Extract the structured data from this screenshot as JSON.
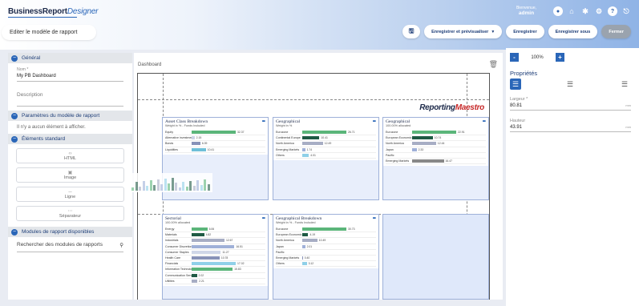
{
  "header": {
    "brand_main": "BusinessReport",
    "brand_sub": "Designer",
    "welcome": "Bienvenue,",
    "user": "admin",
    "icons": [
      "user-icon",
      "home-icon",
      "settings-icon",
      "gear-icon",
      "help-icon",
      "logout-icon"
    ]
  },
  "page_title": "Editer le modèle de rapport",
  "actions": {
    "save_icon": "save-icon",
    "save_preview": "Enregistrer et prévisualiser",
    "save": "Enregistrer",
    "save_as": "Enregistrer sous",
    "close": "Fermer"
  },
  "left": {
    "general": "Général",
    "name_label": "Nom *",
    "name_value": "My PB Dashboard",
    "desc_placeholder": "Description",
    "params_title": "Paramètres du modèle de rapport",
    "params_empty": "Il n'y a aucun élément à afficher.",
    "std_title": "Éléments standard",
    "std_items": [
      "HTML",
      "Image",
      "Ligne",
      "Séparateur"
    ],
    "modules_title": "Modules de rapport disponibles",
    "modules_search": "Rechercher des modules de rapports"
  },
  "canvas": {
    "name": "Dashboard",
    "logo_main": "Reporting",
    "logo_sub": "Maestro",
    "cards": [
      {
        "title": "Asset Class Breakdown",
        "sub": "Weight in % - Funds Included",
        "rows": [
          [
            "Equity",
            32.37,
            "#5bb57a"
          ],
          [
            "Alternative investments",
            2.15,
            "#ccd3e6"
          ],
          [
            "Bonds",
            6.39,
            "#8892b8"
          ],
          [
            "Liquidities",
            10.41,
            "#6fc0d8"
          ]
        ]
      },
      {
        "title": "Geographical",
        "sub": "Weight in %",
        "rows": [
          [
            "Eurozone",
            26.71,
            "#5bb57a"
          ],
          [
            "Continental Europe",
            10.41,
            "#1f5a44"
          ],
          [
            "North America",
            12.49,
            "#a7adc4"
          ],
          [
            "Emerging Markets",
            1.74,
            "#9fb0d8"
          ],
          [
            "Others",
            4.01,
            "#8fd0e8"
          ]
        ]
      },
      {
        "title": "Geographical",
        "sub": "100.00% allocated",
        "rows": [
          [
            "Eurozone",
            22.91,
            "#5bb57a"
          ],
          [
            "European Economic",
            10.74,
            "#1f5a44"
          ],
          [
            "North America",
            12.44,
            "#a7adc4"
          ],
          [
            "Japan",
            2.33,
            "#9fb0d8"
          ],
          [
            "Pacific",
            0,
            "#8fd0e8"
          ],
          [
            "Emerging Markets",
            16.47,
            "#888"
          ]
        ]
      },
      {
        "title": "Sectorial",
        "sub": "100.00% allocated",
        "rows": [
          [
            "Energy",
            6.06,
            "#5bb57a"
          ],
          [
            "Materials",
            4.82,
            "#1f5a44"
          ],
          [
            "Industrials",
            12.67,
            "#a7adc4"
          ],
          [
            "Consumer Discretionary",
            16.51,
            "#9fb0d8"
          ],
          [
            "Consumer Staples",
            11.27,
            "#cfd6e8"
          ],
          [
            "Health Care",
            10.78,
            "#8892b8"
          ],
          [
            "Financials",
            17.02,
            "#8fd0e8"
          ],
          [
            "Information Technology",
            15.83,
            "#5bb57a"
          ],
          [
            "Communication Services",
            2.02,
            "#1f5a44"
          ],
          [
            "Utilities",
            2.21,
            "#a7adc4"
          ]
        ]
      },
      {
        "title": "Geographical Breakdown",
        "sub": "Weight in % - Funds Included",
        "rows": [
          [
            "Eurozone",
            30.73,
            "#5bb57a"
          ],
          [
            "European Economic",
            4.19,
            "#1f5a44"
          ],
          [
            "North America",
            10.49,
            "#a7adc4"
          ],
          [
            "Japan",
            2.01,
            "#9fb0d8"
          ],
          [
            "Pacific",
            0,
            "#cfd6e8"
          ],
          [
            "Emerging Markets",
            0.4,
            "#8892b8"
          ],
          [
            "Others",
            3.12,
            "#8fd0e8"
          ]
        ]
      }
    ]
  },
  "right": {
    "zoom": "100%",
    "zoom_minus": "-",
    "zoom_plus": "+",
    "props_title": "Propriétés",
    "width_label": "Largeur *",
    "width_value": "80.81",
    "width_unit": "mm",
    "height_label": "Hauteur",
    "height_value": "43.91",
    "height_unit": "mm"
  }
}
